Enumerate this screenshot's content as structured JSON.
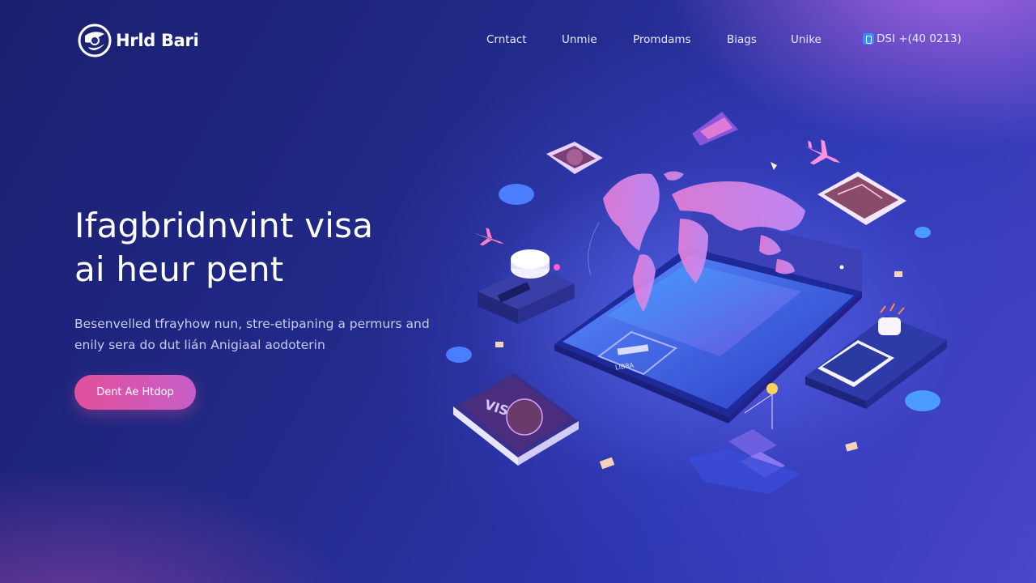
{
  "header": {
    "logo_text": "Hrld Bari",
    "nav": [
      {
        "label": "Crntact"
      },
      {
        "label": "Unmie"
      },
      {
        "label": "Promdams"
      },
      {
        "label": "Biags"
      },
      {
        "label": "Unike"
      }
    ],
    "phone": "DSI +(40 0213)"
  },
  "hero": {
    "headline_line1": "Ifagbridnvint visa",
    "headline_line2": "ai heur pent",
    "sub_line1": "Besenvelled tfrayhow nun, stre-etipaning a permurs and",
    "sub_line2": "enily sera do dut lián Anigiaal aodoterin",
    "cta_label": "Dent Ae Htdop"
  },
  "illustration": {
    "visa_card_label": "VISA",
    "device_label": "LIBRA"
  },
  "colors": {
    "accent_pink": "#e2509b",
    "accent_purple": "#c65ec8",
    "map_pink": "#f0a8e8",
    "bg_dark": "#1a1f6e",
    "bg_light": "#4a47c9"
  },
  "icons": [
    "logo-globe-icon",
    "phone-icon",
    "airplane-icon",
    "map-pin-icon"
  ]
}
